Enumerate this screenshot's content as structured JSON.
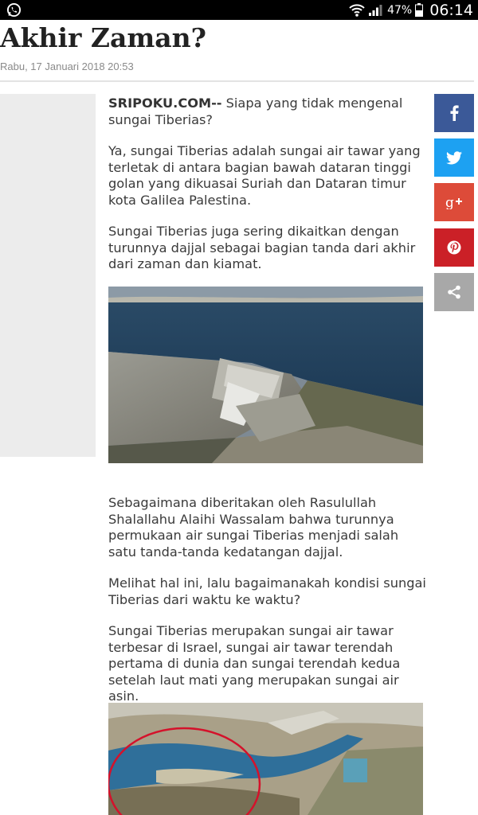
{
  "status_bar": {
    "battery_percent": "47%",
    "time": "06:14"
  },
  "article": {
    "title": "Akhir Zaman?",
    "date": "Rabu, 17 Januari 2018 20:53",
    "source": "SRIPOKU.COM--",
    "p1": " Siapa yang tidak mengenal sungai Tiberias?",
    "p2": "Ya, sungai Tiberias adalah sungai air tawar yang terletak di antara bagian bawah dataran tinggi golan yang dikuasai Suriah dan Dataran timur kota Galilea Palestina.",
    "p3": "Sungai Tiberias juga sering dikaitkan dengan turunnya dajjal sebagai bagian tanda dari akhir dari zaman dan kiamat.",
    "p4": "Sebagaimana diberitakan oleh Rasulullah Shalallahu Alaihi Wassalam bahwa turunnya permukaan air sungai Tiberias menjadi salah satu tanda-tanda kedatangan dajjal.",
    "p5": "Melihat hal ini, lalu bagaimanakah kondisi sungai Tiberias dari waktu ke waktu?",
    "p6": "Sungai Tiberias merupakan sungai air tawar terbesar di Israel, sungai air tawar terendah pertama di dunia dan sungai terendah kedua setelah laut mati yang merupakan sungai air asin."
  },
  "share_buttons": [
    {
      "icon": "facebook-icon",
      "color": "#3b5998"
    },
    {
      "icon": "twitter-icon",
      "color": "#1da1f2"
    },
    {
      "icon": "google-plus-icon",
      "color": "#dd4b39"
    },
    {
      "icon": "pinterest-icon",
      "color": "#cb2027"
    },
    {
      "icon": "share-icon",
      "color": "#a8a8a8"
    }
  ]
}
